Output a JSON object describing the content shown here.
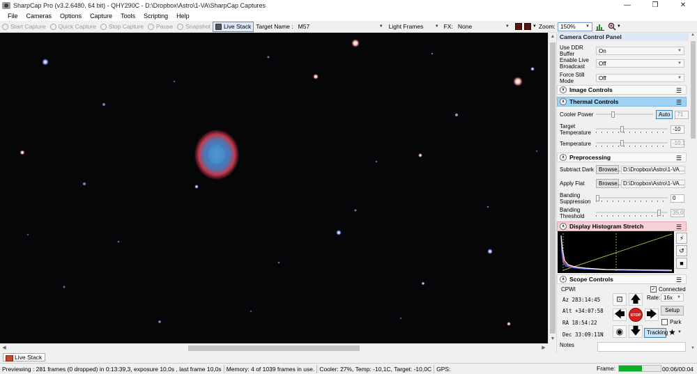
{
  "window": {
    "title": "SharpCap Pro (v3.2.6480, 64 bit) - QHY290C - D:\\Dropbox\\Astro\\1-VA\\SharpCap Captures",
    "minimize": "—",
    "maximize": "❐",
    "close": "✕"
  },
  "menu": [
    "File",
    "Cameras",
    "Options",
    "Capture",
    "Tools",
    "Scripting",
    "Help"
  ],
  "toolbar": {
    "start_capture": "Start Capture",
    "quick_capture": "Quick Capture",
    "stop_capture": "Stop Capture",
    "pause": "Pause",
    "snapshot": "Snapshot",
    "live_stack": "Live Stack",
    "target_name_label": "Target Name :",
    "target_name_value": "M57",
    "frame_type": "Light Frames",
    "fx_label": "FX:",
    "fx_value": "None",
    "zoom_label": "Zoom:",
    "zoom_value": "150%"
  },
  "panel": {
    "title": "Camera Control Panel",
    "use_ddr_label": "Use DDR Buffer",
    "use_ddr_value": "On",
    "live_broadcast_label": "Enable Live Broadcast",
    "live_broadcast_value": "Off",
    "force_still_label": "Force Still Mode",
    "force_still_value": "Off",
    "image_controls": "Image Controls",
    "thermal_controls": "Thermal Controls",
    "cooler_power_label": "Cooler Power",
    "cooler_auto": "Auto",
    "cooler_power_value": "71",
    "cooler_power_level": 0.28,
    "target_temp_label": "Target Temperature",
    "target_temp_value": "-10",
    "target_temp_level": 0.36,
    "temperature_label": "Temperature",
    "temperature_value": "-10,1",
    "temperature_level": 0.36,
    "preprocessing": "Preprocessing",
    "subtract_dark_label": "Subtract Dark",
    "apply_flat_label": "Apply Flat",
    "browse": "Browse...",
    "dark_path": "D:\\Dropbox\\Astro\\1-VA...",
    "flat_path": "D:\\Dropbox\\Astro\\1-VA...",
    "banding_supp_label": "Banding Suppression",
    "banding_supp_value": "0",
    "banding_supp_level": 0.0,
    "banding_thresh_label": "Banding Threshold",
    "banding_thresh_value": "35,0",
    "banding_thresh_level": 0.9,
    "histogram_stretch": "Display Histogram Stretch",
    "scope_controls": "Scope Controls",
    "scope_name": "CPWI",
    "connected_label": "Connected",
    "az": "Az   283:14:45",
    "alt": "Alt +34:07:58",
    "ra": "RA   18:54:22",
    "dec": "Dec  33:09:11N",
    "rate_label": "Rate:",
    "rate_value": "16x",
    "setup": "Setup",
    "park": "Park",
    "tracking": "Tracking",
    "stop": "STOP",
    "notes_label": "Notes"
  },
  "bottom_tab": "Live Stack",
  "status": {
    "previewing": "Previewing : 281 frames (0 dropped) in 0:13:39,3, exposure 10,0s , last frame 10,0s",
    "memory": "Memory: 4 of 1039 frames in use.",
    "cooler": "Cooler: 27%, Temp: -10,1C, Target: -10,0C",
    "gps": "GPS:",
    "frame_label": "Frame:",
    "frame_progress": 0.55,
    "time": "00:06/00:04"
  },
  "colors": {
    "accent_selected": "#9fd3f5",
    "histogram_header": "#f7cfd6",
    "progress_green": "#06b025",
    "stop_red": "#d81e1e"
  }
}
